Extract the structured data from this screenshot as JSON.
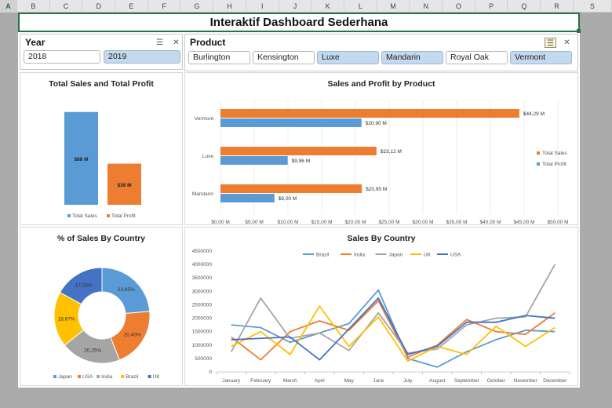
{
  "sheet": {
    "columns": [
      "A",
      "B",
      "C",
      "D",
      "E",
      "F",
      "G",
      "H",
      "I",
      "J",
      "K",
      "L",
      "M",
      "N",
      "O",
      "P",
      "Q",
      "R",
      "S"
    ],
    "selected_column": "A"
  },
  "title": "Interaktif Dashboard Sederhana",
  "year_slicer": {
    "header": "Year",
    "items": [
      {
        "label": "2018",
        "selected": false
      },
      {
        "label": "2019",
        "selected": true
      }
    ]
  },
  "product_slicer": {
    "header": "Product",
    "items": [
      {
        "label": "Burlington",
        "selected": false
      },
      {
        "label": "Kensington",
        "selected": false
      },
      {
        "label": "Luxe",
        "selected": true
      },
      {
        "label": "Mandarin",
        "selected": true
      },
      {
        "label": "Royal Oak",
        "selected": false
      },
      {
        "label": "Vermont",
        "selected": true
      }
    ]
  },
  "colors": {
    "blue": "#5b9bd5",
    "orange": "#ed7d31",
    "gray": "#a5a5a5",
    "yellow": "#ffc000",
    "darkblue": "#4472c4",
    "excel_green": "#217346"
  },
  "chart_data": [
    {
      "type": "bar",
      "title": "Total Sales and  Total Profit",
      "categories": [
        "Total Sales",
        "Total Profit"
      ],
      "values": [
        88,
        39
      ],
      "data_labels": [
        "$88 M",
        "$39 M"
      ],
      "legend": [
        "Total Sales",
        "Total Profit"
      ],
      "ylim": [
        0,
        100
      ]
    },
    {
      "type": "bar",
      "orientation": "horizontal",
      "title": "Sales and Profit by Product",
      "categories": [
        "Vermont",
        "Luxe",
        "Mandarin"
      ],
      "series": [
        {
          "name": "Total  Sales",
          "values": [
            44.29,
            23.12,
            20.95
          ],
          "labels": [
            "$44,29 M",
            "$23,12 M",
            "$20,95 M"
          ]
        },
        {
          "name": "Total Profit",
          "values": [
            20.9,
            9.96,
            8.0
          ],
          "labels": [
            "$20,90 M",
            "$9,96 M",
            "$8,00 M"
          ]
        }
      ],
      "xlim": [
        0,
        50
      ],
      "xticks": [
        "$0,00 M",
        "$5,00 M",
        "$10,00 M",
        "$15,00 M",
        "$20,00 M",
        "$25,00 M",
        "$30,00 M",
        "$35,00 M",
        "$40,00 M",
        "$45,00 M",
        "$50,00 M"
      ],
      "legend_position": "right"
    },
    {
      "type": "pie",
      "donut": true,
      "title": "% of Sales By Country",
      "labels": [
        "Japan",
        "USA",
        "India",
        "Brazil",
        "UK"
      ],
      "values": [
        23.65,
        20.4,
        20.25,
        18.67,
        17.03
      ],
      "value_labels": [
        "23,65%",
        "20,40%",
        "20,25%",
        "18,67%",
        "17,03%"
      ],
      "legend_position": "bottom"
    },
    {
      "type": "line",
      "title": "Sales By Country",
      "x": [
        "January",
        "February",
        "March",
        "April",
        "May",
        "June",
        "July",
        "August",
        "September",
        "October",
        "November",
        "December"
      ],
      "ylim": [
        0,
        4500000
      ],
      "yticks": [
        "0",
        "500000",
        "1000000",
        "1500000",
        "2000000",
        "2500000",
        "3000000",
        "3500000",
        "4000000",
        "4500000"
      ],
      "series": [
        {
          "name": "Brazil",
          "values": [
            1750000,
            1650000,
            1100000,
            1450000,
            1800000,
            3050000,
            500000,
            180000,
            750000,
            1200000,
            1550000,
            1500000
          ]
        },
        {
          "name": "India",
          "values": [
            1300000,
            450000,
            1500000,
            1900000,
            1550000,
            2650000,
            550000,
            1000000,
            1950000,
            1500000,
            1400000,
            2200000
          ]
        },
        {
          "name": "Japan",
          "values": [
            750000,
            2750000,
            1250000,
            1450000,
            800000,
            2200000,
            700000,
            850000,
            1750000,
            2000000,
            2050000,
            4000000
          ]
        },
        {
          "name": "UK",
          "values": [
            950000,
            1500000,
            650000,
            2450000,
            950000,
            2050000,
            400000,
            950000,
            650000,
            1700000,
            950000,
            1650000
          ]
        },
        {
          "name": "USA",
          "values": [
            1200000,
            1250000,
            1300000,
            450000,
            1600000,
            2750000,
            650000,
            950000,
            1850000,
            1850000,
            2100000,
            2000000
          ]
        }
      ],
      "legend_position": "top"
    }
  ]
}
